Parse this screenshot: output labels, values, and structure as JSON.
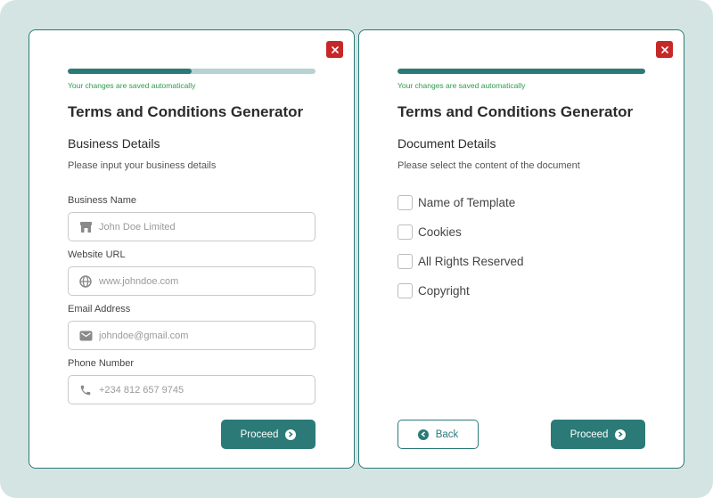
{
  "colors": {
    "accent": "#2b7a77",
    "progress_track": "#b6d2d3",
    "autosave_text": "#2e9a4e",
    "close": "#c62828",
    "background": "#d4e4e3"
  },
  "step1": {
    "progress": 0.5,
    "autosave": "Your changes are saved automatically",
    "title": "Terms and Conditions Generator",
    "section_title": "Business Details",
    "section_desc": "Please input your business details",
    "fields": [
      {
        "label": "Business Name",
        "placeholder": "John Doe Limited",
        "icon": "store-icon"
      },
      {
        "label": "Website URL",
        "placeholder": "www.johndoe.com",
        "icon": "globe-icon"
      },
      {
        "label": "Email Address",
        "placeholder": "johndoe@gmail.com",
        "icon": "mail-icon"
      },
      {
        "label": "Phone Number",
        "placeholder": "+234 812 657 9745",
        "icon": "phone-icon"
      }
    ],
    "proceed_label": "Proceed"
  },
  "step2": {
    "progress": 1.0,
    "autosave": "Your changes are saved automatically",
    "title": "Terms and Conditions Generator",
    "section_title": "Document Details",
    "section_desc": "Please select the content of the document",
    "options": [
      {
        "label": "Name of Template",
        "checked": false
      },
      {
        "label": "Cookies",
        "checked": false
      },
      {
        "label": "All Rights Reserved",
        "checked": false
      },
      {
        "label": "Copyright",
        "checked": false
      }
    ],
    "back_label": "Back",
    "proceed_label": "Proceed"
  }
}
